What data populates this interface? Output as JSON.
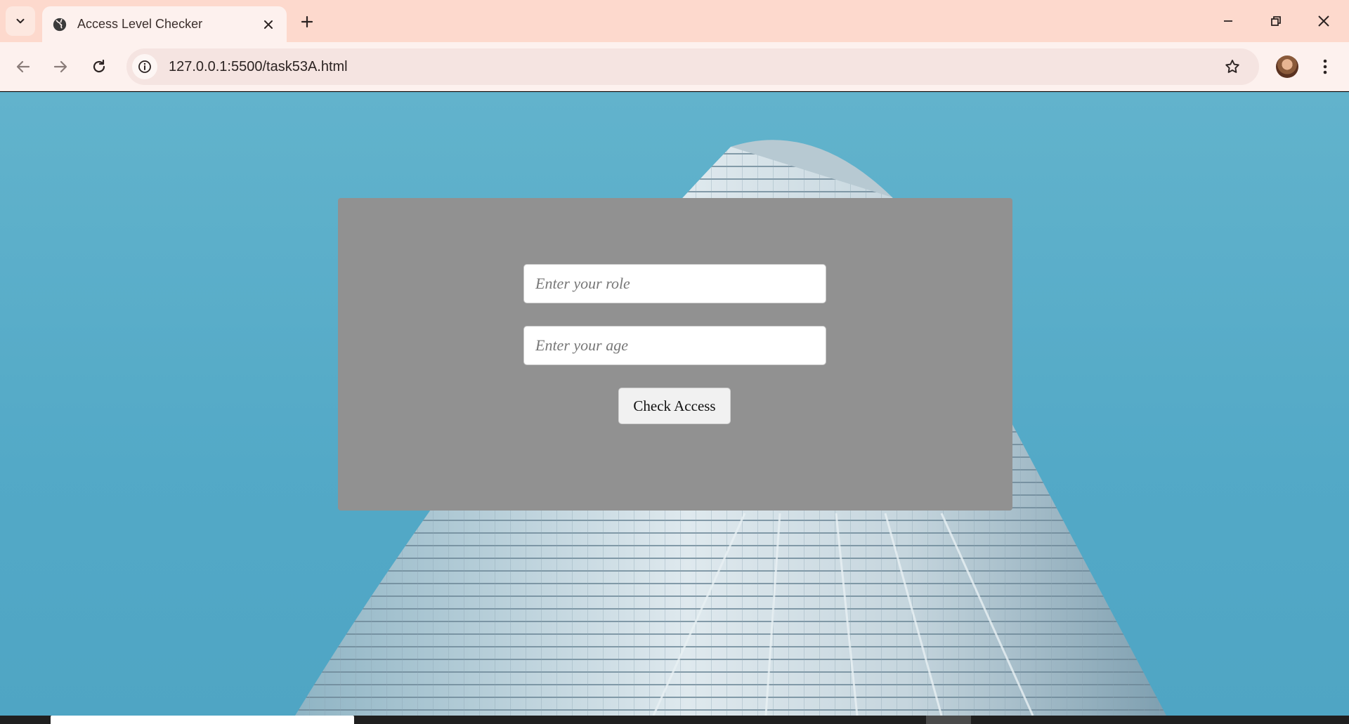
{
  "browser": {
    "tab": {
      "title": "Access Level Checker"
    },
    "address": {
      "url": "127.0.0.1:5500/task53A.html"
    }
  },
  "form": {
    "role_placeholder": "Enter your role",
    "age_placeholder": "Enter your age",
    "check_button_label": "Check Access"
  },
  "icons": {
    "tab_search": "chevron-down-icon",
    "favicon": "globe-icon",
    "tab_close": "close-icon",
    "new_tab": "plus-icon",
    "minimize": "minimize-icon",
    "restore": "restore-icon",
    "close_window": "close-icon",
    "back": "arrow-left-icon",
    "forward": "arrow-right-icon",
    "reload": "reload-icon",
    "site_info": "info-icon",
    "bookmark": "star-icon",
    "menu": "kebab-menu-icon"
  },
  "colors": {
    "tabstrip": "#fdd9cd",
    "toolbar": "#fdf1ee",
    "card": "#919191",
    "sky": "#55abc8"
  }
}
